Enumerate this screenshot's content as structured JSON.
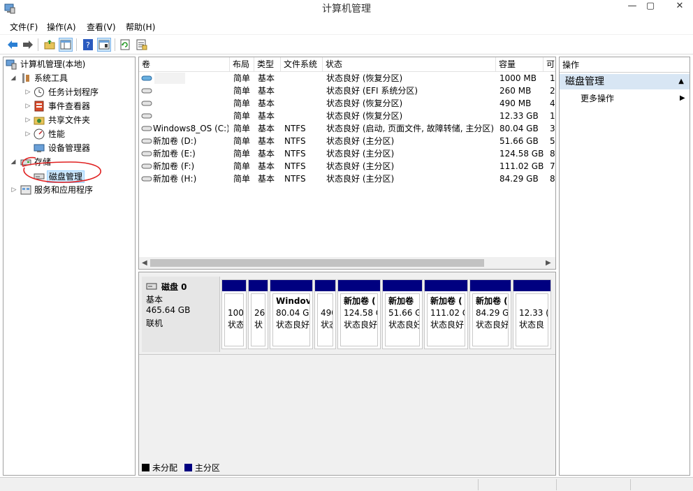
{
  "window": {
    "title": "计算机管理"
  },
  "menu": [
    "文件(F)",
    "操作(A)",
    "查看(V)",
    "帮助(H)"
  ],
  "toolbar": [
    "back-arrow-icon",
    "forward-arrow-icon",
    "folder-up-icon",
    "show-hide-tree-icon",
    "help-icon",
    "properties-icon",
    "refresh-icon",
    "export-list-icon"
  ],
  "tree": {
    "root": "计算机管理(本地)",
    "system_tools": "系统工具",
    "task_scheduler": "任务计划程序",
    "event_viewer": "事件查看器",
    "shared_folders": "共享文件夹",
    "performance": "性能",
    "device_manager": "设备管理器",
    "storage": "存储",
    "disk_management": "磁盘管理",
    "services_apps": "服务和应用程序"
  },
  "volumes": {
    "columns": [
      "卷",
      "布局",
      "类型",
      "文件系统",
      "状态",
      "容量",
      "可"
    ],
    "rows": [
      {
        "name": "",
        "layout": "简单",
        "type": "基本",
        "fs": "",
        "status": "状态良好 (恢复分区)",
        "capacity": "1000 MB",
        "free": "1"
      },
      {
        "name": "",
        "layout": "简单",
        "type": "基本",
        "fs": "",
        "status": "状态良好 (EFI 系统分区)",
        "capacity": "260 MB",
        "free": "2"
      },
      {
        "name": "",
        "layout": "简单",
        "type": "基本",
        "fs": "",
        "status": "状态良好 (恢复分区)",
        "capacity": "490 MB",
        "free": "4"
      },
      {
        "name": "",
        "layout": "简单",
        "type": "基本",
        "fs": "",
        "status": "状态良好 (恢复分区)",
        "capacity": "12.33 GB",
        "free": "1"
      },
      {
        "name": "Windows8_OS (C:)",
        "layout": "简单",
        "type": "基本",
        "fs": "NTFS",
        "status": "状态良好 (启动, 页面文件, 故障转储, 主分区)",
        "capacity": "80.04 GB",
        "free": "3"
      },
      {
        "name": "新加卷 (D:)",
        "layout": "简单",
        "type": "基本",
        "fs": "NTFS",
        "status": "状态良好 (主分区)",
        "capacity": "51.66 GB",
        "free": "5"
      },
      {
        "name": "新加卷 (E:)",
        "layout": "简单",
        "type": "基本",
        "fs": "NTFS",
        "status": "状态良好 (主分区)",
        "capacity": "124.58 GB",
        "free": "8"
      },
      {
        "name": "新加卷 (F:)",
        "layout": "简单",
        "type": "基本",
        "fs": "NTFS",
        "status": "状态良好 (主分区)",
        "capacity": "111.02 GB",
        "free": "7"
      },
      {
        "name": "新加卷 (H:)",
        "layout": "简单",
        "type": "基本",
        "fs": "NTFS",
        "status": "状态良好 (主分区)",
        "capacity": "84.29 GB",
        "free": "8"
      }
    ]
  },
  "disk": {
    "name": "磁盘 0",
    "type": "基本",
    "size": "465.64 GB",
    "status": "联机",
    "partitions": [
      {
        "title": "",
        "size": "100",
        "status": "状态"
      },
      {
        "title": "",
        "size": "26",
        "status": "状"
      },
      {
        "title": "Windov",
        "size": "80.04 GI",
        "status": "状态良好"
      },
      {
        "title": "",
        "size": "490",
        "status": "状态"
      },
      {
        "title": "新加卷 (",
        "size": "124.58 G",
        "status": "状态良好"
      },
      {
        "title": "新加卷",
        "size": "51.66 G",
        "status": "状态良好"
      },
      {
        "title": "新加卷 (",
        "size": "111.02 G",
        "status": "状态良好"
      },
      {
        "title": "新加卷 (",
        "size": "84.29 GI",
        "status": "状态良好"
      },
      {
        "title": "",
        "size": "12.33 (",
        "status": "状态良"
      }
    ]
  },
  "legend": {
    "unallocated": "未分配",
    "primary": "主分区",
    "unallocated_color": "#000000",
    "primary_color": "#000080"
  },
  "actions": {
    "header": "操作",
    "section": "磁盘管理",
    "more": "更多操作"
  },
  "colors": {
    "partition_header": "#000080",
    "selection": "#cce8ff",
    "annotation": "#e02020"
  }
}
